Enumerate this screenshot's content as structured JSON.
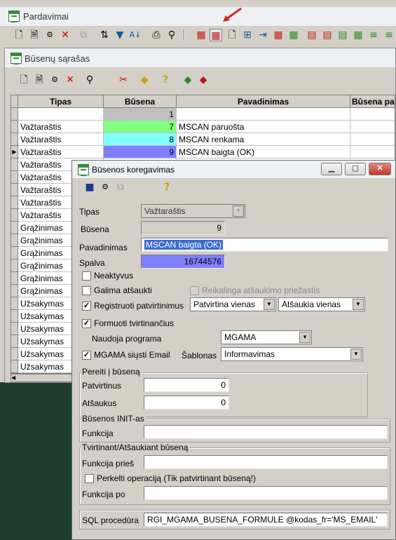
{
  "main_window": {
    "title": "Pardavimai"
  },
  "list_window": {
    "title": "Būsenų sąrašas",
    "columns": [
      "Tipas",
      "Būsena",
      "Pavadinimas",
      "Būsena pat"
    ],
    "rows": [
      {
        "tipas": "",
        "busena": "1",
        "pavadinimas": "",
        "color": "#c0c0c0"
      },
      {
        "tipas": "Važtaraštis",
        "busena": "7",
        "pavadinimas": "MSCAN paruošta",
        "color": "#80ff80"
      },
      {
        "tipas": "Važtaraštis",
        "busena": "8",
        "pavadinimas": "MSCAN renkama",
        "color": "#80ffff"
      },
      {
        "tipas": "Važtaraštis",
        "busena": "9",
        "pavadinimas": "MSCAN baigta (OK)",
        "color": "#8080ff"
      },
      {
        "tipas": "Važtaraštis",
        "busena": "",
        "pavadinimas": "",
        "color": ""
      },
      {
        "tipas": "Važtaraštis",
        "busena": "",
        "pavadinimas": "",
        "color": ""
      },
      {
        "tipas": "Važtaraštis",
        "busena": "",
        "pavadinimas": "",
        "color": ""
      },
      {
        "tipas": "Važtaraštis",
        "busena": "",
        "pavadinimas": "",
        "color": ""
      },
      {
        "tipas": "Važtaraštis",
        "busena": "",
        "pavadinimas": "",
        "color": ""
      },
      {
        "tipas": "Grąžinimas",
        "busena": "",
        "pavadinimas": "",
        "color": ""
      },
      {
        "tipas": "Grąžinimas",
        "busena": "",
        "pavadinimas": "",
        "color": ""
      },
      {
        "tipas": "Grąžinimas",
        "busena": "",
        "pavadinimas": "",
        "color": ""
      },
      {
        "tipas": "Grąžinimas",
        "busena": "",
        "pavadinimas": "",
        "color": ""
      },
      {
        "tipas": "Grąžinimas",
        "busena": "",
        "pavadinimas": "",
        "color": ""
      },
      {
        "tipas": "Grąžinimas",
        "busena": "",
        "pavadinimas": "",
        "color": ""
      },
      {
        "tipas": "Užsakymas",
        "busena": "",
        "pavadinimas": "",
        "color": ""
      },
      {
        "tipas": "Užsakymas",
        "busena": "",
        "pavadinimas": "",
        "color": ""
      },
      {
        "tipas": "Užsakymas",
        "busena": "",
        "pavadinimas": "",
        "color": ""
      },
      {
        "tipas": "Užsakymas",
        "busena": "",
        "pavadinimas": "",
        "color": ""
      },
      {
        "tipas": "Užsakymas",
        "busena": "",
        "pavadinimas": "",
        "color": ""
      },
      {
        "tipas": "Užsakymas",
        "busena": "",
        "pavadinimas": "",
        "color": ""
      },
      {
        "tipas": "Užsakymas",
        "busena": "",
        "pavadinimas": "",
        "color": ""
      }
    ],
    "current_row": 3
  },
  "dialog": {
    "title": "Būsenos koregavimas",
    "labels": {
      "tipas": "Tipas",
      "busena": "Būsena",
      "pavadinimas": "Pavadinimas",
      "spalva": "Spalva",
      "neaktyvus": "Neaktyvus",
      "galima_atsaukti": "Galima atšaukti",
      "reikalinga_priezastis": "Reikalinga atšaukimo priežastis",
      "registruoti": "Registruoti patvirtinimus",
      "formuoti": "Formuoti tvirtinančius",
      "naudoja_programa": "Naudoja programa",
      "mgama_siusti": "MGAMA siųsti Email",
      "sablonas": "Šablonas",
      "pereiti_group": "Pereiti į būseną",
      "patvirtinus": "Patvirtinus",
      "atsaukus": "Atšaukus",
      "init_group": "Būsenos INIT-as",
      "funkcija": "Funkcija",
      "tvirtinant_group": "Tvirtinant/Atšaukiant būseną",
      "funkcija_pries": "Funkcija prieš",
      "perkelti": "Perkelti operaciją (Tik patvirtinant būseną!)",
      "funkcija_po": "Funkcija po",
      "sql": "SQL procedūra"
    },
    "values": {
      "tipas": "Važtaraštis",
      "busena": "9",
      "pavadinimas": "MSCAN baigta (OK)",
      "spalva": "16744576",
      "spalva_color": "#8080ff",
      "patvirtina": "Patvirtina vienas",
      "atsaukia": "Atšaukia vienas",
      "programa": "MGAMA",
      "sablonas": "Informavimas",
      "patvirtinus": "0",
      "atsaukus": "0",
      "funkcija": "",
      "funkcija_pries": "",
      "funkcija_po": "",
      "sql": "RGI_MGAMA_BUSENA_FORMULE @kodas_fr='MS_EMAIL'"
    },
    "checks": {
      "neaktyvus": false,
      "galima_atsaukti": false,
      "reikalinga_priezastis": false,
      "registruoti": true,
      "formuoti": true,
      "mgama_siusti": true,
      "perkelti": false
    }
  },
  "colors": {
    "arrow": "#e02020"
  }
}
